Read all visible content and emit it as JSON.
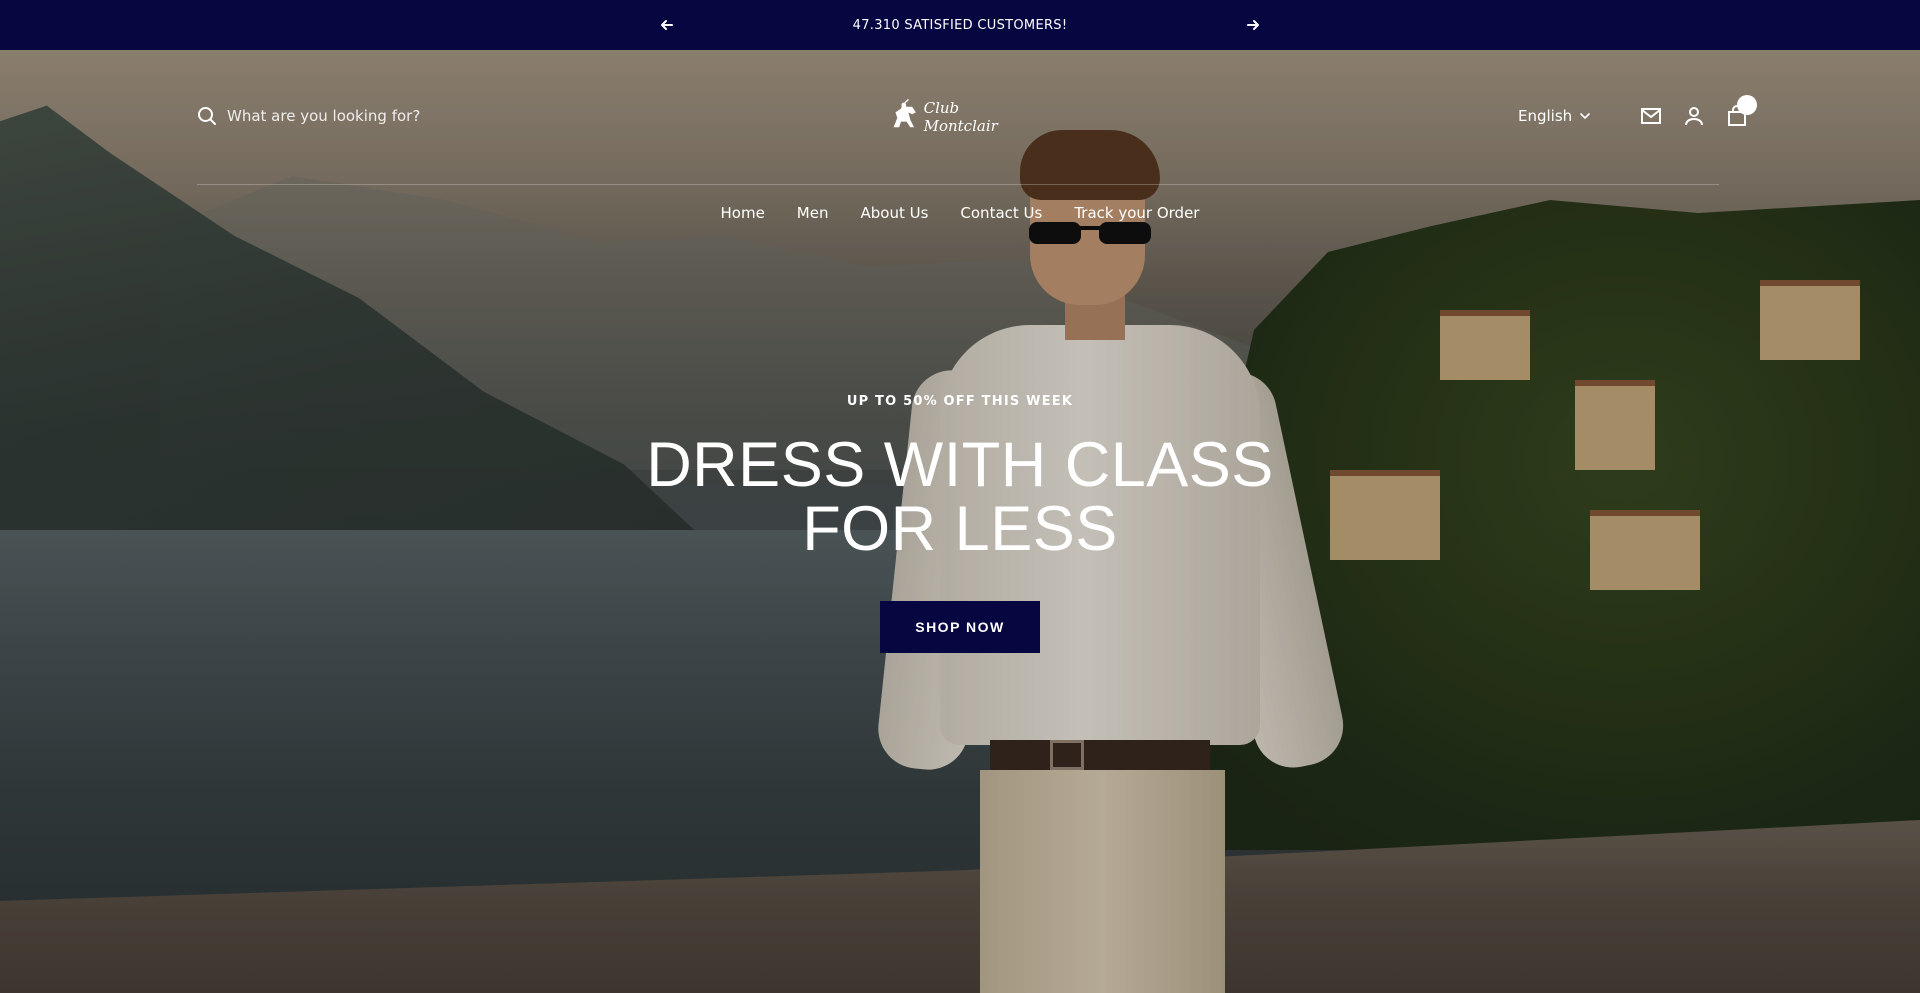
{
  "announcement": {
    "text": "47.310 SATISFIED CUSTOMERS!",
    "prev_icon": "arrow-left-icon",
    "next_icon": "arrow-right-icon"
  },
  "header": {
    "search": {
      "placeholder": "What are you looking for?",
      "value": "",
      "icon": "search-icon"
    },
    "logo": {
      "text": "Club Montclair"
    },
    "language": {
      "selected": "English",
      "icon": "chevron-down-icon"
    },
    "icons": [
      "mail-icon",
      "account-icon",
      "cart-icon"
    ],
    "cart_count": ""
  },
  "nav": {
    "items": [
      {
        "label": "Home"
      },
      {
        "label": "Men"
      },
      {
        "label": "About Us"
      },
      {
        "label": "Contact Us"
      },
      {
        "label": "Track your Order"
      }
    ]
  },
  "hero": {
    "eyebrow": "UP TO 50% OFF THIS WEEK",
    "headline_line1": "DRESS WITH CLASS",
    "headline_line2": "FOR LESS",
    "cta_label": "SHOP NOW"
  },
  "colors": {
    "brand_navy": "#060640",
    "text": "#ffffff"
  }
}
